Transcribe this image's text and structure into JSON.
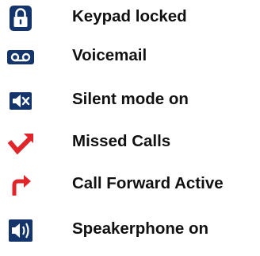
{
  "legend": {
    "items": [
      {
        "icon": "padlock-icon",
        "label": "Keypad locked"
      },
      {
        "icon": "voicemail-icon",
        "label": "Voicemail"
      },
      {
        "icon": "speaker-muted-icon",
        "label": "Silent mode on"
      },
      {
        "icon": "missed-call-arrow-icon",
        "label": "Missed Calls"
      },
      {
        "icon": "call-forward-arrow-icon",
        "label": "Call Forward Active"
      },
      {
        "icon": "speakerphone-icon",
        "label": "Speakerphone on"
      }
    ]
  },
  "colors": {
    "icon_dark": "#14356b",
    "icon_red": "#e0262a",
    "text": "#111111"
  }
}
